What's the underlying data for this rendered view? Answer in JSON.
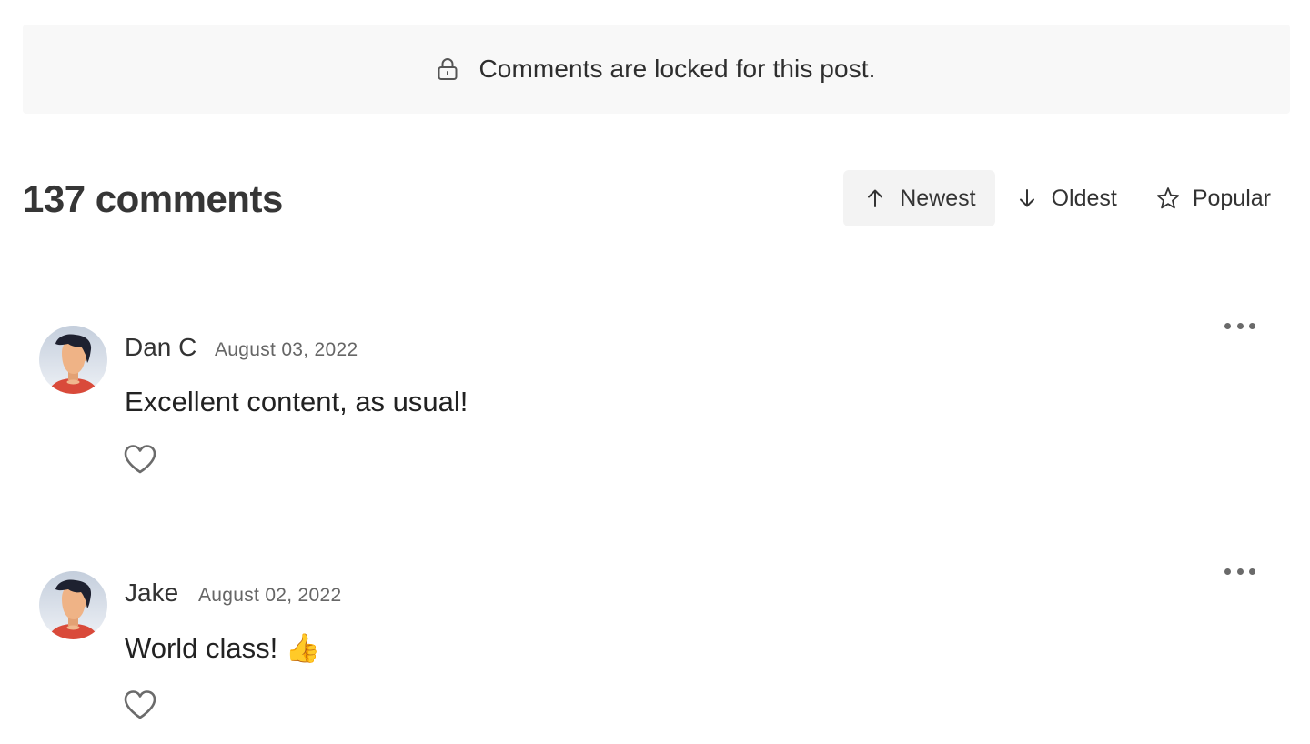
{
  "banner": {
    "icon": "lock-icon",
    "text": "Comments are locked for this post."
  },
  "comments_header": {
    "title": "137 comments",
    "sort_options": [
      {
        "label": "Newest",
        "icon": "arrow-up-icon",
        "active": true
      },
      {
        "label": "Oldest",
        "icon": "arrow-down-icon",
        "active": false
      },
      {
        "label": "Popular",
        "icon": "star-icon",
        "active": false
      }
    ]
  },
  "comments": [
    {
      "author": "Dan C",
      "date": "August 03, 2022",
      "text": "Excellent content, as usual!"
    },
    {
      "author": "Jake",
      "date": "August 02, 2022",
      "text": "World class! 👍"
    }
  ],
  "colors": {
    "banner_bg": "#f8f8f8",
    "active_sort_bg": "#f3f3f3",
    "text": "#333333",
    "muted": "#666666",
    "avatar_shirt": "#d94a3a",
    "avatar_skin": "#efb386",
    "avatar_hair": "#1e2130"
  }
}
